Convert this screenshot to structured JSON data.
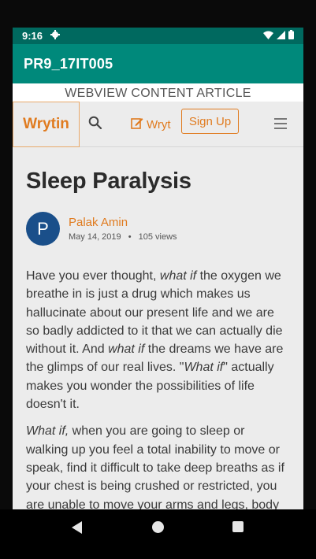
{
  "status_bar": {
    "time": "9:16",
    "icons": [
      "gear-icon",
      "wifi-icon",
      "signal-icon",
      "battery-icon"
    ]
  },
  "app_bar": {
    "title": "PR9_17IT005"
  },
  "webview": {
    "title": "WEBVIEW CONTENT ARTICLE"
  },
  "site_nav": {
    "logo": "Wrytin",
    "search_icon": "search-icon",
    "write_label": "Wryt",
    "signup_label": "Sign Up",
    "menu_icon": "hamburger-menu-icon"
  },
  "article": {
    "title": "Sleep Paralysis",
    "author": {
      "initial": "P",
      "name": "Palak Amin",
      "date": "May 14, 2019",
      "separator": "•",
      "views": "105 views"
    },
    "paragraphs": [
      {
        "parts": [
          {
            "text": "Have you ever thought, ",
            "italic": false
          },
          {
            "text": "what if",
            "italic": true
          },
          {
            "text": " the oxygen we breathe in is just a drug which makes us hallucinate about our present life and we are so badly addicted to it that we can actually die without it. And ",
            "italic": false
          },
          {
            "text": "what if",
            "italic": true
          },
          {
            "text": " the dreams we have are the glimps of our real lives. \"",
            "italic": false
          },
          {
            "text": "What if",
            "italic": true
          },
          {
            "text": "\" actually makes you wonder the possibilities of life doesn't it.",
            "italic": false
          }
        ]
      },
      {
        "parts": [
          {
            "text": "What if,",
            "italic": true
          },
          {
            "text": " when you are going to sleep or walking up you feel a total inability to move or speak, find it difficult to take deep breaths as if your chest is being crushed or restricted, you are unable to move your arms and legs, body and",
            "italic": false
          }
        ]
      }
    ]
  },
  "colors": {
    "status_bar": "#00695f",
    "app_bar": "#00897b",
    "accent": "#e07b1f",
    "avatar": "#1a4f8a"
  }
}
